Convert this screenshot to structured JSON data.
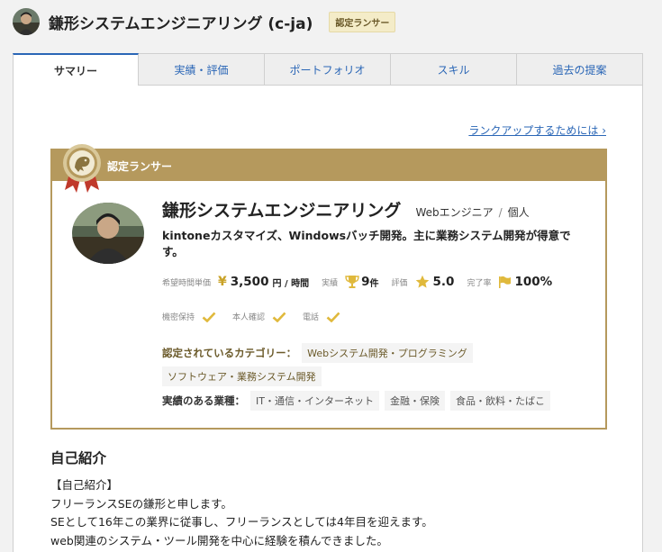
{
  "header": {
    "title": "鎌形システムエンジニアリング (c-ja)",
    "badge": "認定ランサー"
  },
  "tabs": [
    {
      "label": "サマリー",
      "active": true
    },
    {
      "label": "実績・評価",
      "active": false
    },
    {
      "label": "ポートフォリオ",
      "active": false
    },
    {
      "label": "スキル",
      "active": false
    },
    {
      "label": "過去の提案",
      "active": false
    }
  ],
  "rankup_link": "ランクアップするためには",
  "card": {
    "header_label": "認定ランサー",
    "name": "鎌形システムエンジニアリング",
    "job": "Webエンジニア",
    "separator": "/",
    "kind": "個人",
    "catch": "kintoneカスタマイズ、Windowsバッチ開発。主に業務システム開発が得意です。",
    "stats": {
      "rate_label": "希望時間単価",
      "rate_currency": "¥",
      "rate_value": "3,500",
      "rate_unit": "円 / 時間",
      "jobs_label": "実績",
      "jobs_value": "9",
      "jobs_unit": "件",
      "rating_label": "評価",
      "rating_value": "5.0",
      "completion_label": "完了率",
      "completion_value": "100%"
    },
    "verifications": [
      {
        "label": "機密保持",
        "verified": true
      },
      {
        "label": "本人確認",
        "verified": true
      },
      {
        "label": "電話",
        "verified": true
      }
    ],
    "categories_label": "認定されているカテゴリー：",
    "categories": [
      "Webシステム開発・プログラミング",
      "ソフトウェア・業務システム開発"
    ],
    "industries_label": "実績のある業種：",
    "industries": [
      "IT・通信・インターネット",
      "金融・保険",
      "食品・飲料・たばこ"
    ]
  },
  "intro": {
    "title": "自己紹介",
    "lines": [
      "【自己紹介】",
      "フリーランスSEの鎌形と申します。",
      "SEとして16年この業界に従事し、フリーランスとしては4年目を迎えます。",
      "web関連のシステム・ツール開発を中心に経験を積んできました。"
    ]
  },
  "colors": {
    "gold": "#b5995d",
    "link": "#2a66b6",
    "check": "#e0b93c"
  }
}
